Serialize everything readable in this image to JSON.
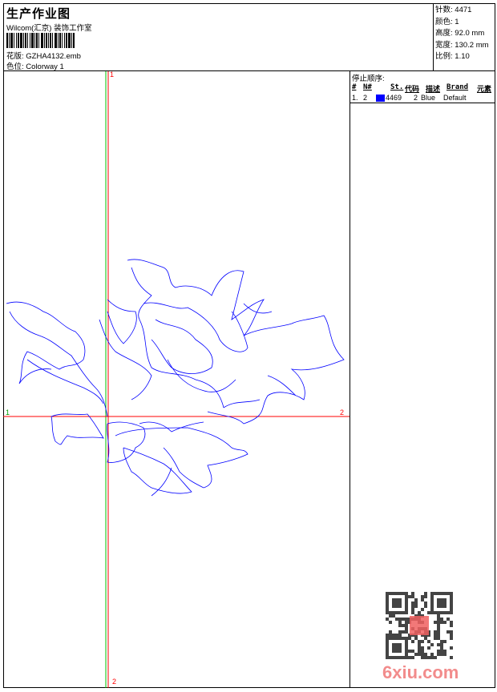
{
  "header": {
    "title": "生产作业图",
    "company": "Wilcom(汇京) 装饰工作室",
    "design_label": "花版:",
    "design_value": "GZHA4132.emb",
    "colorway_label": "色位:",
    "colorway_value": "Colorway 1"
  },
  "info": [
    {
      "label": "针数:",
      "value": "4471"
    },
    {
      "label": "颜色:",
      "value": "1"
    },
    {
      "label": "高度:",
      "value": "92.0 mm"
    },
    {
      "label": "宽度:",
      "value": "130.2 mm"
    },
    {
      "label": "比例:",
      "value": "1.10"
    }
  ],
  "stop_sequence": {
    "title": "停止顺序:",
    "columns": [
      "#",
      "N#",
      "St.",
      "代码",
      "描述",
      "Brand",
      "元素"
    ],
    "rows": [
      {
        "index": "1.",
        "needle": "2",
        "color": "#0000ff",
        "stitches": "4469",
        "code": "2",
        "desc": "Blue",
        "brand": "Default"
      }
    ]
  },
  "axis_labels": {
    "top": "1",
    "bottom": "2",
    "left": "1",
    "right": "2"
  },
  "watermark": "6xiu.com",
  "colors": {
    "thread": "#0000ff",
    "axis_red": "#ff0000",
    "axis_green": "#00c000"
  }
}
